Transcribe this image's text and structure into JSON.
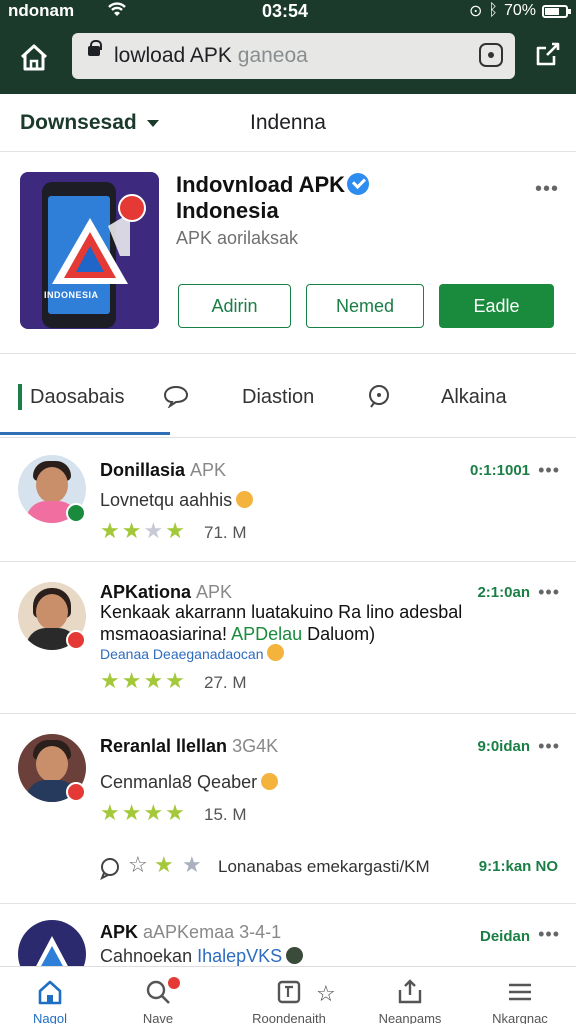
{
  "status_bar": {
    "carrier": "ndonam",
    "time": "03:54",
    "battery": "70%",
    "battery_level": 0.7
  },
  "browser": {
    "url_main": "lowload APK",
    "url_rest": "ganeoa"
  },
  "subheader": {
    "dropdown_label": "Downsesad",
    "title": "Indenna"
  },
  "app": {
    "name_line1": "Indovnload APK",
    "name_line2": "Indonesia",
    "subtitle": "APK aorilaksak",
    "icon_text": "INDONESIA",
    "buttons": {
      "first": "Adirin",
      "second": "Nemed",
      "primary": "Eadle"
    }
  },
  "tabs": [
    {
      "label": "Daosabais"
    },
    {
      "label": "Diastion"
    },
    {
      "label": "Alkaina"
    }
  ],
  "reviews": [
    {
      "name": "Donillasia",
      "tag": "APK",
      "time": "0:1:1001",
      "text": "Lovnetqu aahhis",
      "rating": 3,
      "count": "71. M"
    },
    {
      "name": "APKationa",
      "tag": "APK",
      "time": "2:1:0an",
      "text_line1": "Kenkaak akarrann luatakuino Ra lino adesbal",
      "text_line2_a": "msmaoasiarina! ",
      "text_line2_green": "APDelau",
      "text_line2_b": " Daluom)",
      "link": "Deanaa Deaeganadaocan",
      "rating": 4,
      "count": "27. M"
    },
    {
      "name": "Reranlal llellan",
      "tag": "3G4K",
      "time": "9:0idan",
      "text": "Cenmanla8 Qeaber",
      "rating": 4,
      "count": "15. M"
    }
  ],
  "action_row": {
    "text": "Lonanabas emekargasti/KM",
    "time": "9:1:kan NO"
  },
  "partial_review": {
    "name": "APK",
    "tag": "aAPKemaa 3-4-1",
    "time": "Deidan",
    "text_a": "Cahnoekan ",
    "text_link": "IhalepVKS"
  },
  "bottom_nav": [
    {
      "label": "Nagol"
    },
    {
      "label": "Nave"
    },
    {
      "label": "Roondenaith"
    },
    {
      "label": "Neanpams"
    },
    {
      "label": "Nkargnac"
    }
  ]
}
